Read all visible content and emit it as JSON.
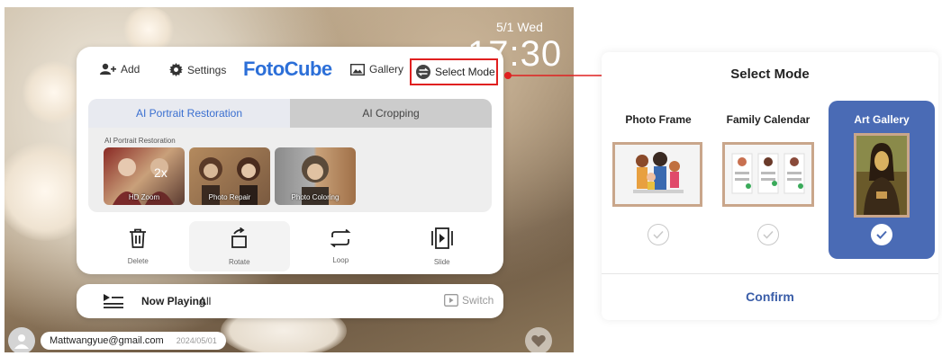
{
  "clock": {
    "date": "5/1  Wed",
    "time": "17:30"
  },
  "topbar": {
    "add_label": "Add",
    "settings_label": "Settings",
    "logo": "FotoCube",
    "gallery_label": "Gallery",
    "select_mode_label": "Select Mode"
  },
  "features": {
    "tabs": [
      {
        "label": "AI Portrait Restoration",
        "active": true
      },
      {
        "label": "AI Cropping",
        "active": false
      }
    ],
    "section_title": "AI Portrait Restoration",
    "zoom_badge": "2x",
    "items": [
      {
        "label": "HD Zoom"
      },
      {
        "label": "Photo Repair"
      },
      {
        "label": "Photo Coloring"
      }
    ]
  },
  "actions": [
    {
      "label": "Delete",
      "icon": "trash-icon"
    },
    {
      "label": "Rotate",
      "icon": "rotate-icon"
    },
    {
      "label": "Loop",
      "icon": "loop-icon"
    },
    {
      "label": "Slide",
      "icon": "slide-icon"
    }
  ],
  "now_playing": {
    "label": "Now Playing",
    "value": "All",
    "switch_label": "Switch"
  },
  "user": {
    "email": "Mattwangyue@gmail.com",
    "date": "2024/05/01"
  },
  "modal": {
    "title": "Select Mode",
    "modes": [
      {
        "label": "Photo Frame",
        "selected": false
      },
      {
        "label": "Family Calendar",
        "selected": false
      },
      {
        "label": "Art Gallery",
        "selected": true
      }
    ],
    "confirm_label": "Confirm"
  },
  "colors": {
    "accent": "#4a6bb5",
    "logo": "#2c6fd8",
    "highlight": "#e02020",
    "frame": "#c9a68b"
  }
}
